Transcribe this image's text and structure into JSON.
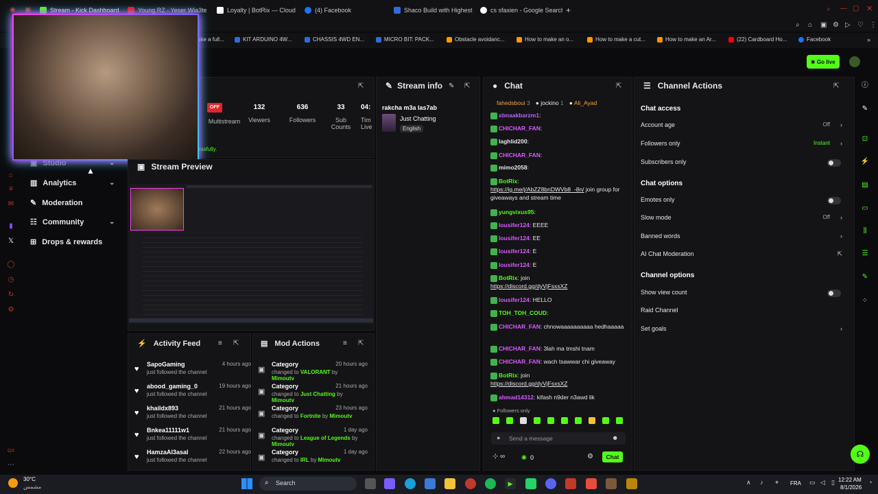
{
  "browser": {
    "tabs": [
      {
        "label": "Stream - Kick Dashboard",
        "color": "#53fc18",
        "active": true
      },
      {
        "label": "Young RZ - Yeser Wia3tek",
        "color": "#ff0000"
      },
      {
        "label": "Loyalty | BotRix — Cloud S",
        "color": "#ffffff"
      },
      {
        "label": "(4) Facebook",
        "color": "#1877f2"
      },
      {
        "label": "Shaco Build with Highest W",
        "color": "#2a6fdb"
      },
      {
        "label": "cs sfaxien - Google Search",
        "color": "#ffffff"
      }
    ],
    "new_tab": "+",
    "bookmarks": [
      {
        "label": "ake a full...",
        "color": "#999"
      },
      {
        "label": "KIT ARDUINO 4W...",
        "color": "#2a6fdb"
      },
      {
        "label": "CHASSIS 4WD EN...",
        "color": "#2a6fdb"
      },
      {
        "label": "MICRO BIT: PACK...",
        "color": "#2a6fdb"
      },
      {
        "label": "Obstacle avoidanc...",
        "color": "#ff9900"
      },
      {
        "label": "How to make an o...",
        "color": "#ff9900"
      },
      {
        "label": "How to make a cut...",
        "color": "#ff9900"
      },
      {
        "label": "How to make an Ar...",
        "color": "#ff9900"
      },
      {
        "label": "(22) Cardboard Ho...",
        "color": "#ff0000"
      },
      {
        "label": "Facebook",
        "color": "#1877f2"
      }
    ]
  },
  "header": {
    "go_live": "Go live"
  },
  "leftnav": {
    "studio": "Studio",
    "analytics": "Analytics",
    "moderation": "Moderation",
    "community": "Community",
    "drops": "Drops & rewards"
  },
  "session": {
    "status_badge": "OFF",
    "stats": [
      {
        "value": "",
        "label": "Multistream"
      },
      {
        "value": "132",
        "label": "Viewers"
      },
      {
        "value": "636",
        "label": "Followers"
      },
      {
        "value": "33",
        "label": "Sub Counts"
      },
      {
        "value": "04:",
        "label": "Tim Live"
      }
    ],
    "toast_fragment": "essfully."
  },
  "stream_info": {
    "title": "Stream info",
    "stream_title": "rakcha m3a las7ab",
    "category": "Just Chatting",
    "language": "English"
  },
  "stream_preview": {
    "title": "Stream Preview"
  },
  "activity_feed": {
    "title": "Activity Feed",
    "items": [
      {
        "name": "SapoGaming",
        "sub": "just followed the channel",
        "time": "4 hours ago"
      },
      {
        "name": "abood_gaming_0",
        "sub": "just followed the channel",
        "time": "19 hours ago"
      },
      {
        "name": "khaildx893",
        "sub": "just followed the channel",
        "time": "21 hours ago"
      },
      {
        "name": "Bnkea11111w1",
        "sub": "just followed the channel",
        "time": "21 hours ago"
      },
      {
        "name": "HamzaAl3asal",
        "sub": "just followed the channel",
        "time": "22 hours ago"
      }
    ]
  },
  "mod_actions": {
    "title": "Mod Actions",
    "items": [
      {
        "name": "Category",
        "pre": "changed to ",
        "game": "VALORANT",
        "by": " by ",
        "mod": "Mimoutv",
        "time": "20 hours ago"
      },
      {
        "name": "Category",
        "pre": "changed to ",
        "game": "Just Chatting",
        "by": " by ",
        "mod": "Mimoutv",
        "time": "21 hours ago"
      },
      {
        "name": "Category",
        "pre": "changed to ",
        "game": "Fortnite",
        "by": " by ",
        "mod": "Mimoutv",
        "time": "23 hours ago"
      },
      {
        "name": "Category",
        "pre": "changed to ",
        "game": "League of Legends",
        "by": " by ",
        "mod": "Mimoutv",
        "time": "1 day ago"
      },
      {
        "name": "Category",
        "pre": "changed to ",
        "game": "IRL",
        "by": " by ",
        "mod": "Mimoutv",
        "time": "1 day ago"
      }
    ]
  },
  "chat": {
    "title": "Chat",
    "top_chatters": [
      {
        "name": "fahedsboui",
        "count": "3",
        "color": "#f4a73b"
      },
      {
        "name": "jockino",
        "count": "1",
        "color": "#e8e8ea"
      },
      {
        "name": "Ali_Ayad",
        "count": "",
        "color": "#f4a73b"
      }
    ],
    "messages": [
      {
        "user": "xbnaakbarzm1",
        "color": "#b566ff",
        "text": ""
      },
      {
        "user": "CHICHAR_FAN",
        "color": "#d95aff",
        "text": ""
      },
      {
        "user": "laghlid200",
        "color": "#e8e8ea",
        "text": ""
      },
      {
        "user": "CHICHAR_FAN",
        "color": "#d95aff",
        "text": ""
      },
      {
        "user": "mimo2058",
        "color": "#e8e8ea",
        "text": ""
      },
      {
        "user": "BotRix",
        "color": "#53fc18",
        "text": "",
        "link": "https://ig.me/j/AbZZ8bnDWVb8_-8n/",
        "text2": " join group for giveaways and stream time"
      },
      {
        "user": "yungvixus95",
        "color": "#53fc18",
        "text": ""
      },
      {
        "user": "lousifer124",
        "color": "#d95aff",
        "text": "EEEE"
      },
      {
        "user": "lousifer124",
        "color": "#d95aff",
        "text": "EE"
      },
      {
        "user": "lousifer124",
        "color": "#d95aff",
        "text": "E"
      },
      {
        "user": "lousifer124",
        "color": "#d95aff",
        "text": "E"
      },
      {
        "user": "BotRix",
        "color": "#53fc18",
        "text": "join",
        "link": "https://discord.gg/dyVjFsxsXZ"
      },
      {
        "user": "lousifer124",
        "color": "#d95aff",
        "text": "HELLO"
      },
      {
        "user": "TOH_TOH_COUD",
        "color": "#53fc18",
        "text": ""
      },
      {
        "user": "CHICHAR_FAN",
        "color": "#d95aff",
        "text": "chnowaaaaaaaaaa hedhaaaaa"
      },
      {
        "user": "CHICHAR_FAN",
        "color": "#d95aff",
        "text": "3lah ma tmshi tnam"
      },
      {
        "user": "CHICHAR_FAN",
        "color": "#d95aff",
        "text": "wach tsawwar chi giveaway"
      },
      {
        "user": "BotRix",
        "color": "#53fc18",
        "text": "join",
        "link": "https://discord.gg/dyVjFsxsXZ"
      },
      {
        "user": "ahmad14312",
        "color": "#d95aff",
        "text": "kifash n9der n3awd lik"
      }
    ],
    "followers_only": "Followers only",
    "placeholder": "Send a message",
    "points": "0",
    "send": "Chat"
  },
  "channel_actions": {
    "title": "Channel Actions",
    "chat_access": "Chat access",
    "rows_access": [
      {
        "label": "Account age",
        "value": "Off",
        "type": "arrow"
      },
      {
        "label": "Followers only",
        "value": "Instant",
        "type": "arrow"
      },
      {
        "label": "Subscribers only",
        "value": "",
        "type": "toggle"
      }
    ],
    "chat_options": "Chat options",
    "rows_options": [
      {
        "label": "Emotes only",
        "value": "",
        "type": "toggle"
      },
      {
        "label": "Slow mode",
        "value": "Off",
        "type": "arrow"
      },
      {
        "label": "Banned words",
        "value": "",
        "type": "arrow"
      },
      {
        "label": "AI Chat Moderation",
        "value": "",
        "type": "ext"
      }
    ],
    "channel_options": "Channel options",
    "rows_channel": [
      {
        "label": "Show view count",
        "value": "",
        "type": "toggle"
      },
      {
        "label": "Raid Channel",
        "value": "",
        "type": "none"
      },
      {
        "label": "Set goals",
        "value": "",
        "type": "arrow"
      }
    ]
  },
  "taskbar": {
    "weather_temp": "30°C",
    "weather_desc": "مشمس",
    "search": "Search",
    "lang": "FRA",
    "time": "12:22 AM",
    "date": "8/1/2026"
  },
  "colors": {
    "accent": "#53fc18",
    "bg": "#0b0b0d",
    "panel": "#141416"
  }
}
